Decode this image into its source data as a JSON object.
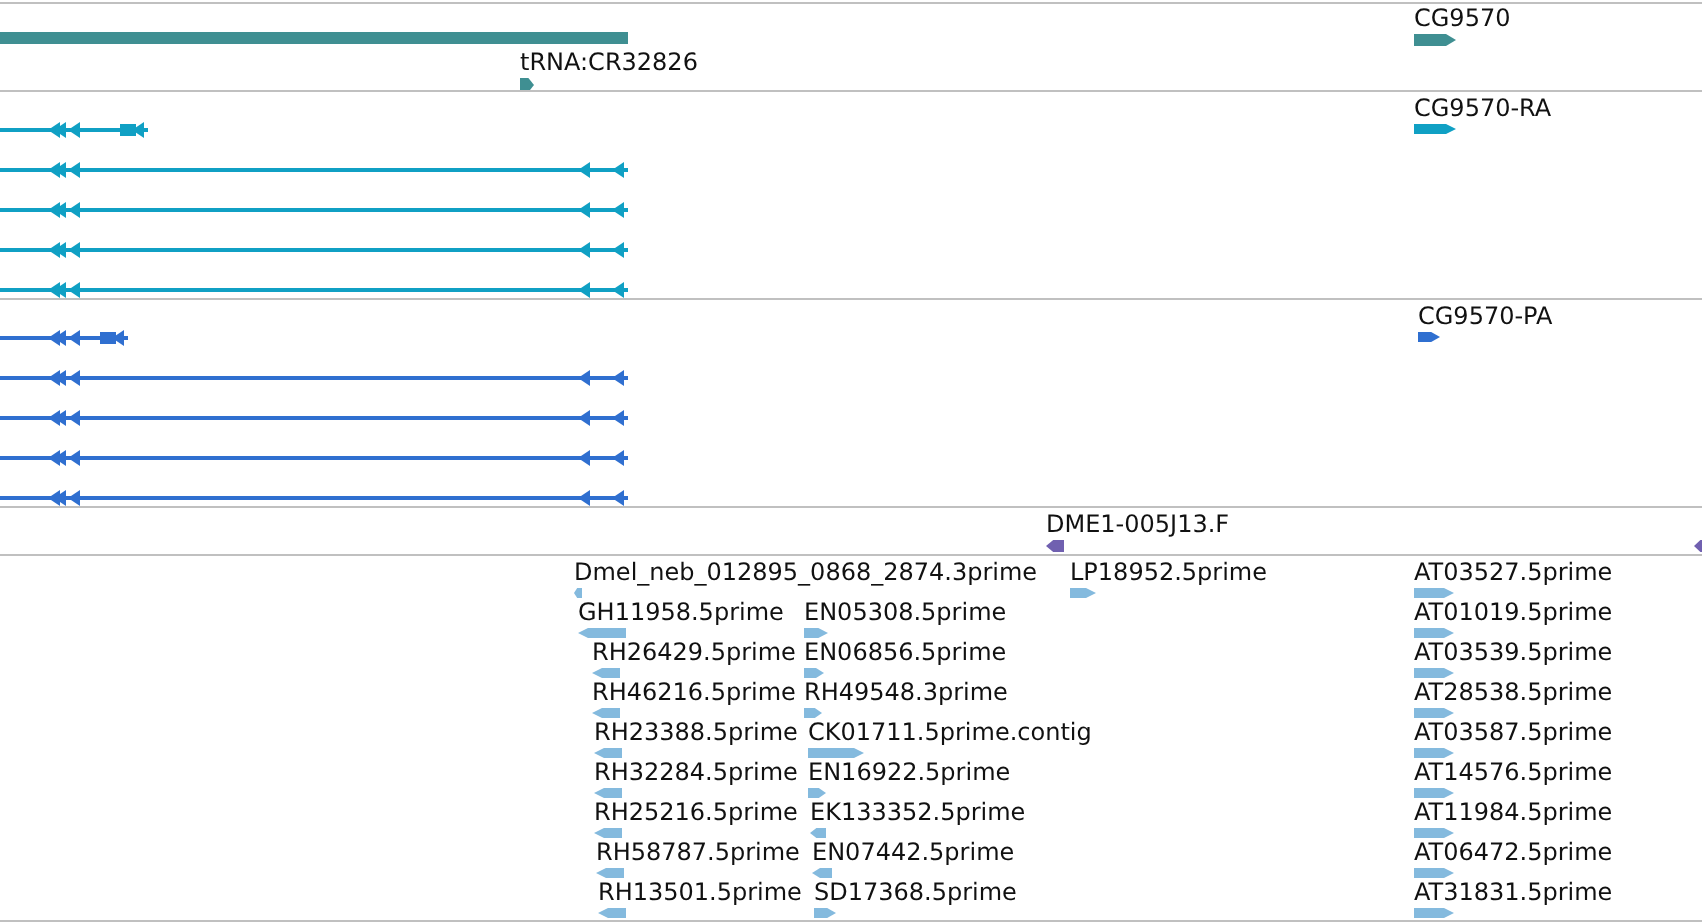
{
  "tracks": [
    {
      "kind": "gene",
      "features": [
        {
          "label": "tRNA:CR32826",
          "reverse": false
        },
        {
          "label": "CG9570",
          "reverse": false
        }
      ]
    },
    {
      "kind": "transcript",
      "features": [
        {
          "label": "CG9570-RA",
          "reverse": false
        }
      ]
    },
    {
      "kind": "protein",
      "features": [
        {
          "label": "CG9570-PA",
          "reverse": false
        }
      ]
    },
    {
      "kind": "match",
      "features": [
        {
          "label": "DME1-005J13.F",
          "reverse": true
        }
      ]
    },
    {
      "kind": "est",
      "features": [
        {
          "label": "Dmel_neb_012895_0868_2874.3prime",
          "reverse": true
        },
        {
          "label": "LP18952.5prime",
          "reverse": false
        },
        {
          "label": "AT03527.5prime",
          "reverse": false
        },
        {
          "label": "GH11958.5prime",
          "reverse": true
        },
        {
          "label": "EN05308.5prime",
          "reverse": false
        },
        {
          "label": "AT01019.5prime",
          "reverse": false
        },
        {
          "label": "RH26429.5prime",
          "reverse": true
        },
        {
          "label": "EN06856.5prime",
          "reverse": false
        },
        {
          "label": "AT03539.5prime",
          "reverse": false
        },
        {
          "label": "RH46216.5prime",
          "reverse": true
        },
        {
          "label": "RH49548.3prime",
          "reverse": false
        },
        {
          "label": "AT28538.5prime",
          "reverse": false
        },
        {
          "label": "RH23388.5prime",
          "reverse": true
        },
        {
          "label": "CK01711.5prime.contig",
          "reverse": false
        },
        {
          "label": "AT03587.5prime",
          "reverse": false
        },
        {
          "label": "RH32284.5prime",
          "reverse": true
        },
        {
          "label": "EN16922.5prime",
          "reverse": false
        },
        {
          "label": "AT14576.5prime",
          "reverse": false
        },
        {
          "label": "RH25216.5prime",
          "reverse": true
        },
        {
          "label": "EK133352.5prime",
          "reverse": true
        },
        {
          "label": "AT11984.5prime",
          "reverse": false
        },
        {
          "label": "RH58787.5prime",
          "reverse": true
        },
        {
          "label": "EN07442.5prime",
          "reverse": true
        },
        {
          "label": "AT06472.5prime",
          "reverse": false
        },
        {
          "label": "RH13501.5prime",
          "reverse": true
        },
        {
          "label": "SD17368.5prime",
          "reverse": false
        },
        {
          "label": "AT31831.5prime",
          "reverse": false
        }
      ]
    }
  ]
}
